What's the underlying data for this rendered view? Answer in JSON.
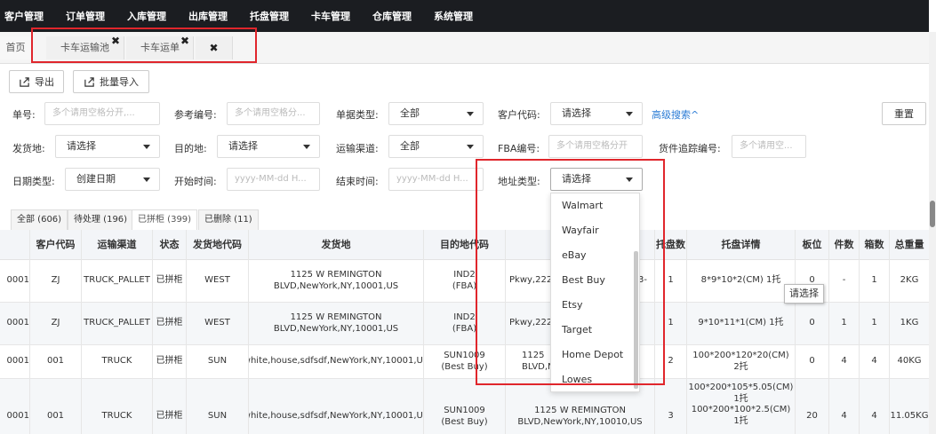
{
  "topnav": [
    "客户管理",
    "订单管理",
    "入库管理",
    "出库管理",
    "托盘管理",
    "卡车管理",
    "仓库管理",
    "系统管理"
  ],
  "tabs": {
    "home": "首页",
    "pool": "卡车运输池",
    "waybill": "卡车运单"
  },
  "toolbar": {
    "export": "导出",
    "batch_import": "批量导入"
  },
  "filters": {
    "order_no_label": "单号:",
    "order_no_placeholder": "多个请用空格分开,...",
    "ref_no_label": "参考编号:",
    "ref_no_placeholder": "多个请用空格分...",
    "doc_type_label": "单据类型:",
    "doc_type_value": "全部",
    "customer_code_label": "客户代码:",
    "customer_code_value": "请选择",
    "advanced_search": "高级搜索^",
    "reset": "重置",
    "origin_label": "发货地:",
    "origin_value": "请选择",
    "destination_label": "目的地:",
    "destination_value": "请选择",
    "channel_label": "运输渠道:",
    "channel_value": "全部",
    "fba_label": "FBA编号:",
    "fba_placeholder": "多个请用空格分开",
    "tracking_label": "货件追踪编号:",
    "tracking_placeholder": "多个请用空...",
    "date_type_label": "日期类型:",
    "date_type_value": "创建日期",
    "start_label": "开始时间:",
    "start_placeholder": "yyyy-MM-dd H...",
    "end_label": "结束时间:",
    "end_placeholder": "yyyy-MM-dd H...",
    "address_type_label": "地址类型:",
    "address_type_value": "请选择"
  },
  "status_tabs": [
    "全部 (606)",
    "待处理 (196)",
    "已拼柜 (399)",
    "已删除 (11)"
  ],
  "table": {
    "headers": [
      "客户代码",
      "运输渠道",
      "状态",
      "发货地代码",
      "发货地",
      "目的地代码",
      "托盘数",
      "托盘详情",
      "板位",
      "件数",
      "箱数",
      "总重量"
    ],
    "rows": [
      {
        "id": "0001",
        "customer": "ZJ",
        "channel": "TRUCK_PALLET",
        "status": "已拼柜",
        "origin_code": "WEST",
        "origin_1": "1125 W REMINGTON",
        "origin_2": "BLVD,NewYork,NY,10001,US",
        "dest_code_1": "IND2",
        "dest_code_2": "(FBA)",
        "dest_addr_1": "Pkwy,2222",
        "dest_addr_2": "",
        "dest_tail": "3-",
        "pallets": "1",
        "detail_1": "8*9*10*2(CM)  1托",
        "detail_2": "",
        "detail_3": "",
        "slots": "0",
        "pieces": "-",
        "boxes": "1",
        "weight": "2KG"
      },
      {
        "id": "0001",
        "customer": "ZJ",
        "channel": "TRUCK_PALLET",
        "status": "已拼柜",
        "origin_code": "WEST",
        "origin_1": "1125 W REMINGTON",
        "origin_2": "BLVD,NewYork,NY,10001,US",
        "dest_code_1": "IND2",
        "dest_code_2": "(FBA)",
        "dest_addr_1": "Pkwy,2222",
        "dest_addr_2": "",
        "dest_tail": "",
        "pallets": "1",
        "detail_1": "9*10*11*1(CM)  1托",
        "detail_2": "",
        "detail_3": "",
        "slots": "0",
        "pieces": "1",
        "boxes": "1",
        "weight": "1KG"
      },
      {
        "id": "0001",
        "customer": "001",
        "channel": "TRUCK",
        "status": "已拼柜",
        "origin_code": "SUN",
        "origin_1": "white,house,sdfsdf,NewYork,NY,10001,US",
        "origin_2": "",
        "dest_code_1": "SUN1009",
        "dest_code_2": "(Best Buy)",
        "dest_addr_1": "1125",
        "dest_addr_2": "BLVD,N",
        "dest_tail": "",
        "pallets": "2",
        "detail_1": "100*200*120*20(CM)",
        "detail_2": "2托",
        "detail_3": "",
        "slots": "0",
        "pieces": "4",
        "boxes": "4",
        "weight": "40KG"
      },
      {
        "id": "0001",
        "customer": "001",
        "channel": "TRUCK",
        "status": "已拼柜",
        "origin_code": "SUN",
        "origin_1": "white,house,sdfsdf,NewYork,NY,10001,US",
        "origin_2": "",
        "dest_code_1": "SUN1009",
        "dest_code_2": "(Best Buy)",
        "dest_addr_1": "1125 W REMINGTON",
        "dest_addr_2": "BLVD,NewYork,NY,10010,US",
        "dest_tail": "",
        "pallets": "3",
        "detail_1": "100*200*105*5.05(CM)",
        "detail_2": "1托",
        "detail_3": "100*200*100*2.5(CM)",
        "detail_4": "1托",
        "slots": "20",
        "pieces": "4",
        "boxes": "4",
        "weight": "11.05KG"
      }
    ]
  },
  "dropdown_options": [
    "Walmart",
    "Wayfair",
    "eBay",
    "Best Buy",
    "Etsy",
    "Target",
    "Home Depot",
    "Lowes"
  ],
  "tooltip": "请选择",
  "colors": {
    "nav_bg": "#1b1d21",
    "highlight": "#e0262c",
    "link": "#2a7bd5"
  }
}
